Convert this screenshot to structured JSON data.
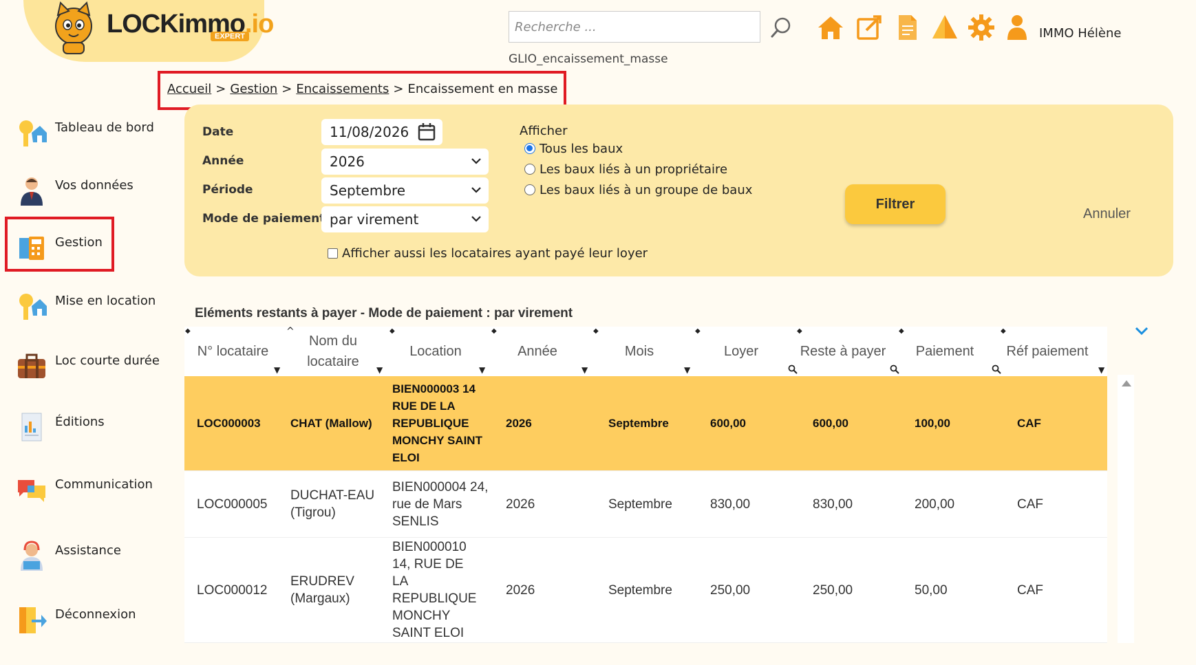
{
  "logo": {
    "name": "LOCKimmo",
    "suffix": ".io",
    "badge": "EXPERT"
  },
  "header": {
    "search_placeholder": "Recherche ...",
    "user_name": "IMMO Hélène",
    "page_code": "GLIO_encaissement_masse",
    "icons": [
      "home-icon",
      "edit-icon",
      "document-icon",
      "alert-icon",
      "gear-icon",
      "user-icon"
    ]
  },
  "breadcrumb": {
    "home": "Accueil",
    "gestion": "Gestion",
    "encaissements": "Encaissements",
    "current": "Encaissement en masse",
    "sep": ">"
  },
  "sidebar": {
    "items": [
      {
        "label": "Tableau de bord",
        "icon": "key-house-icon"
      },
      {
        "label": "Vos données",
        "icon": "person-icon"
      },
      {
        "label": "Gestion",
        "icon": "calculator-icon"
      },
      {
        "label": "Mise en location",
        "icon": "key-house-icon"
      },
      {
        "label": "Loc courte durée",
        "icon": "suitcase-icon"
      },
      {
        "label": "Éditions",
        "icon": "report-icon"
      },
      {
        "label": "Communication",
        "icon": "chat-icon"
      },
      {
        "label": "Assistance",
        "icon": "support-icon"
      },
      {
        "label": "Déconnexion",
        "icon": "logout-icon"
      }
    ]
  },
  "filters": {
    "date_label": "Date",
    "date_value": "11/08/2026",
    "annee_label": "Année",
    "annee_value": "2026",
    "periode_label": "Période",
    "periode_value": "Septembre",
    "mode_label": "Mode de paiement",
    "mode_value": "par virement",
    "afficher_label": "Afficher",
    "radio_all": "Tous les baux",
    "radio_owner": "Les baux liés à un propriétaire",
    "radio_group": "Les baux liés à un groupe de baux",
    "checkbox_label": "Afficher aussi les locataires ayant payé leur loyer",
    "filter_button": "Filtrer",
    "cancel_button": "Annuler"
  },
  "table": {
    "title": "Eléments restants à payer - Mode de paiement : par virement",
    "columns": [
      "N° locataire",
      "Nom du locataire",
      "Location",
      "Année",
      "Mois",
      "Loyer",
      "Reste à payer",
      "Paiement",
      "Réf paiement"
    ],
    "rows": [
      {
        "no": "LOC000003",
        "nom": "CHAT (Mallow)",
        "location": "BIEN000003 14 RUE DE LA REPUBLIQUE MONCHY SAINT ELOI",
        "annee": "2026",
        "mois": "Septembre",
        "loyer": "600,00",
        "reste": "600,00",
        "paiement": "100,00",
        "ref": "CAF"
      },
      {
        "no": "LOC000005",
        "nom": "DUCHAT-EAU (Tigrou)",
        "location": "BIEN000004 24, rue de Mars SENLIS",
        "annee": "2026",
        "mois": "Septembre",
        "loyer": "830,00",
        "reste": "830,00",
        "paiement": "200,00",
        "ref": "CAF"
      },
      {
        "no": "LOC000012",
        "nom": "ERUDREV (Margaux)",
        "location": "BIEN000010 14, RUE DE LA REPUBLIQUE MONCHY SAINT ELOI",
        "annee": "2026",
        "mois": "Septembre",
        "loyer": "250,00",
        "reste": "250,00",
        "paiement": "50,00",
        "ref": "CAF"
      }
    ]
  },
  "colors": {
    "accent": "#fbc93e",
    "panel": "#fde9a8",
    "selected_row": "#fecd5f",
    "highlight": "#e01b24",
    "icon_orange": "#f59a1b"
  }
}
